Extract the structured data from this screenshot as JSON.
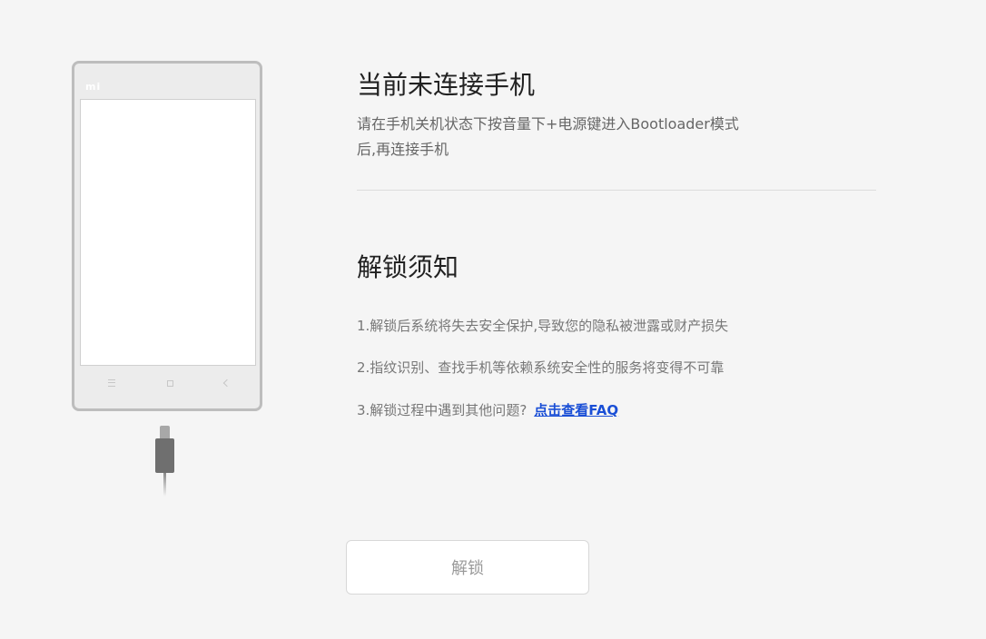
{
  "phone": {
    "brand_logo": "mi"
  },
  "status": {
    "title": "当前未连接手机",
    "desc_line1": "请在手机关机状态下按音量下+电源键进入Bootloader模式",
    "desc_line2": "后,再连接手机"
  },
  "notice": {
    "title": "解锁须知",
    "item1": "1.解锁后系统将失去安全保护,导致您的隐私被泄露或财产损失",
    "item2": "2.指纹识别、查找手机等依赖系统安全性的服务将变得不可靠",
    "item3": "3.解锁过程中遇到其他问题?",
    "faq_link": "点击查看FAQ"
  },
  "actions": {
    "unlock_label": "解锁"
  },
  "colors": {
    "background": "#f5f5f5",
    "link": "#1a4fd6",
    "button_text": "#9a9a9a"
  }
}
